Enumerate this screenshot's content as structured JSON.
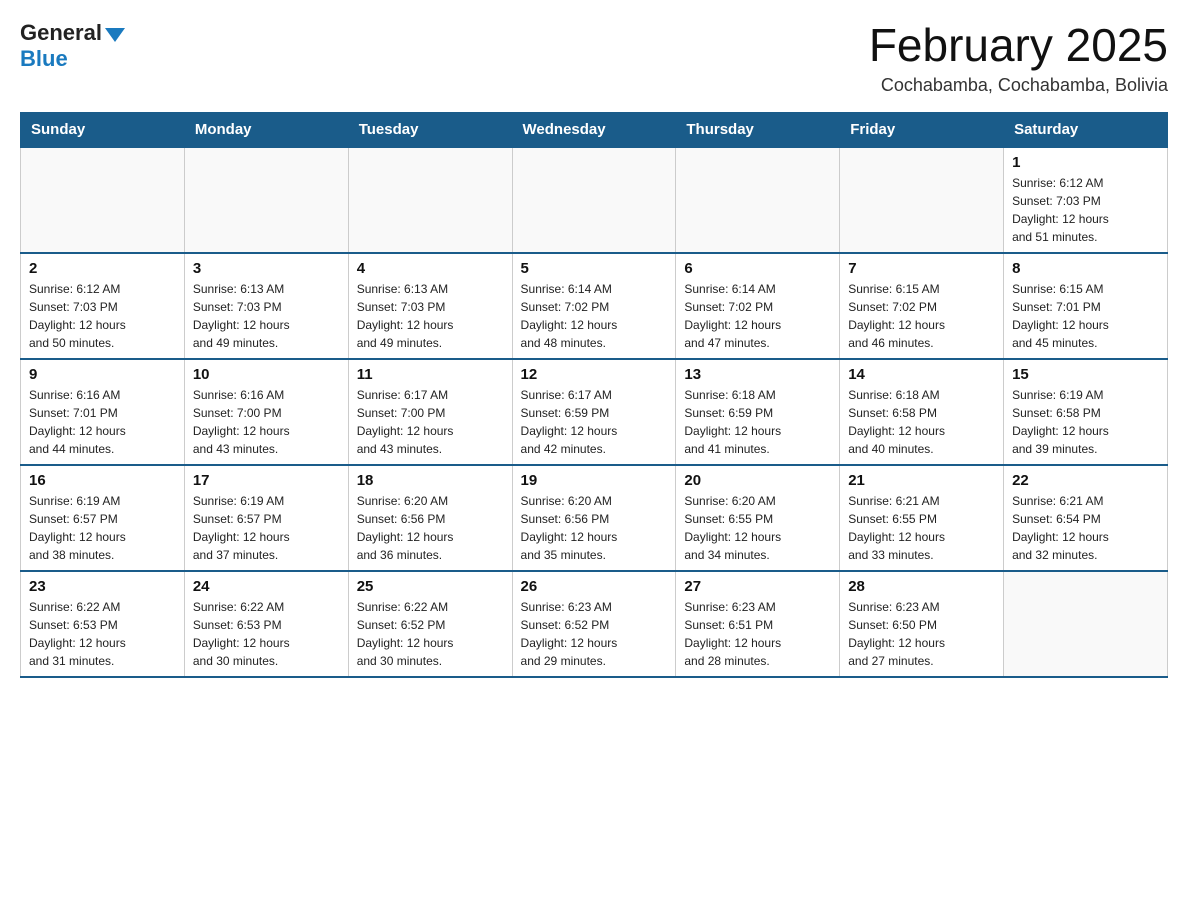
{
  "logo": {
    "general": "General",
    "blue": "Blue"
  },
  "header": {
    "title": "February 2025",
    "location": "Cochabamba, Cochabamba, Bolivia"
  },
  "weekdays": [
    "Sunday",
    "Monday",
    "Tuesday",
    "Wednesday",
    "Thursday",
    "Friday",
    "Saturday"
  ],
  "weeks": [
    [
      {
        "day": "",
        "info": ""
      },
      {
        "day": "",
        "info": ""
      },
      {
        "day": "",
        "info": ""
      },
      {
        "day": "",
        "info": ""
      },
      {
        "day": "",
        "info": ""
      },
      {
        "day": "",
        "info": ""
      },
      {
        "day": "1",
        "info": "Sunrise: 6:12 AM\nSunset: 7:03 PM\nDaylight: 12 hours\nand 51 minutes."
      }
    ],
    [
      {
        "day": "2",
        "info": "Sunrise: 6:12 AM\nSunset: 7:03 PM\nDaylight: 12 hours\nand 50 minutes."
      },
      {
        "day": "3",
        "info": "Sunrise: 6:13 AM\nSunset: 7:03 PM\nDaylight: 12 hours\nand 49 minutes."
      },
      {
        "day": "4",
        "info": "Sunrise: 6:13 AM\nSunset: 7:03 PM\nDaylight: 12 hours\nand 49 minutes."
      },
      {
        "day": "5",
        "info": "Sunrise: 6:14 AM\nSunset: 7:02 PM\nDaylight: 12 hours\nand 48 minutes."
      },
      {
        "day": "6",
        "info": "Sunrise: 6:14 AM\nSunset: 7:02 PM\nDaylight: 12 hours\nand 47 minutes."
      },
      {
        "day": "7",
        "info": "Sunrise: 6:15 AM\nSunset: 7:02 PM\nDaylight: 12 hours\nand 46 minutes."
      },
      {
        "day": "8",
        "info": "Sunrise: 6:15 AM\nSunset: 7:01 PM\nDaylight: 12 hours\nand 45 minutes."
      }
    ],
    [
      {
        "day": "9",
        "info": "Sunrise: 6:16 AM\nSunset: 7:01 PM\nDaylight: 12 hours\nand 44 minutes."
      },
      {
        "day": "10",
        "info": "Sunrise: 6:16 AM\nSunset: 7:00 PM\nDaylight: 12 hours\nand 43 minutes."
      },
      {
        "day": "11",
        "info": "Sunrise: 6:17 AM\nSunset: 7:00 PM\nDaylight: 12 hours\nand 43 minutes."
      },
      {
        "day": "12",
        "info": "Sunrise: 6:17 AM\nSunset: 6:59 PM\nDaylight: 12 hours\nand 42 minutes."
      },
      {
        "day": "13",
        "info": "Sunrise: 6:18 AM\nSunset: 6:59 PM\nDaylight: 12 hours\nand 41 minutes."
      },
      {
        "day": "14",
        "info": "Sunrise: 6:18 AM\nSunset: 6:58 PM\nDaylight: 12 hours\nand 40 minutes."
      },
      {
        "day": "15",
        "info": "Sunrise: 6:19 AM\nSunset: 6:58 PM\nDaylight: 12 hours\nand 39 minutes."
      }
    ],
    [
      {
        "day": "16",
        "info": "Sunrise: 6:19 AM\nSunset: 6:57 PM\nDaylight: 12 hours\nand 38 minutes."
      },
      {
        "day": "17",
        "info": "Sunrise: 6:19 AM\nSunset: 6:57 PM\nDaylight: 12 hours\nand 37 minutes."
      },
      {
        "day": "18",
        "info": "Sunrise: 6:20 AM\nSunset: 6:56 PM\nDaylight: 12 hours\nand 36 minutes."
      },
      {
        "day": "19",
        "info": "Sunrise: 6:20 AM\nSunset: 6:56 PM\nDaylight: 12 hours\nand 35 minutes."
      },
      {
        "day": "20",
        "info": "Sunrise: 6:20 AM\nSunset: 6:55 PM\nDaylight: 12 hours\nand 34 minutes."
      },
      {
        "day": "21",
        "info": "Sunrise: 6:21 AM\nSunset: 6:55 PM\nDaylight: 12 hours\nand 33 minutes."
      },
      {
        "day": "22",
        "info": "Sunrise: 6:21 AM\nSunset: 6:54 PM\nDaylight: 12 hours\nand 32 minutes."
      }
    ],
    [
      {
        "day": "23",
        "info": "Sunrise: 6:22 AM\nSunset: 6:53 PM\nDaylight: 12 hours\nand 31 minutes."
      },
      {
        "day": "24",
        "info": "Sunrise: 6:22 AM\nSunset: 6:53 PM\nDaylight: 12 hours\nand 30 minutes."
      },
      {
        "day": "25",
        "info": "Sunrise: 6:22 AM\nSunset: 6:52 PM\nDaylight: 12 hours\nand 30 minutes."
      },
      {
        "day": "26",
        "info": "Sunrise: 6:23 AM\nSunset: 6:52 PM\nDaylight: 12 hours\nand 29 minutes."
      },
      {
        "day": "27",
        "info": "Sunrise: 6:23 AM\nSunset: 6:51 PM\nDaylight: 12 hours\nand 28 minutes."
      },
      {
        "day": "28",
        "info": "Sunrise: 6:23 AM\nSunset: 6:50 PM\nDaylight: 12 hours\nand 27 minutes."
      },
      {
        "day": "",
        "info": ""
      }
    ]
  ]
}
